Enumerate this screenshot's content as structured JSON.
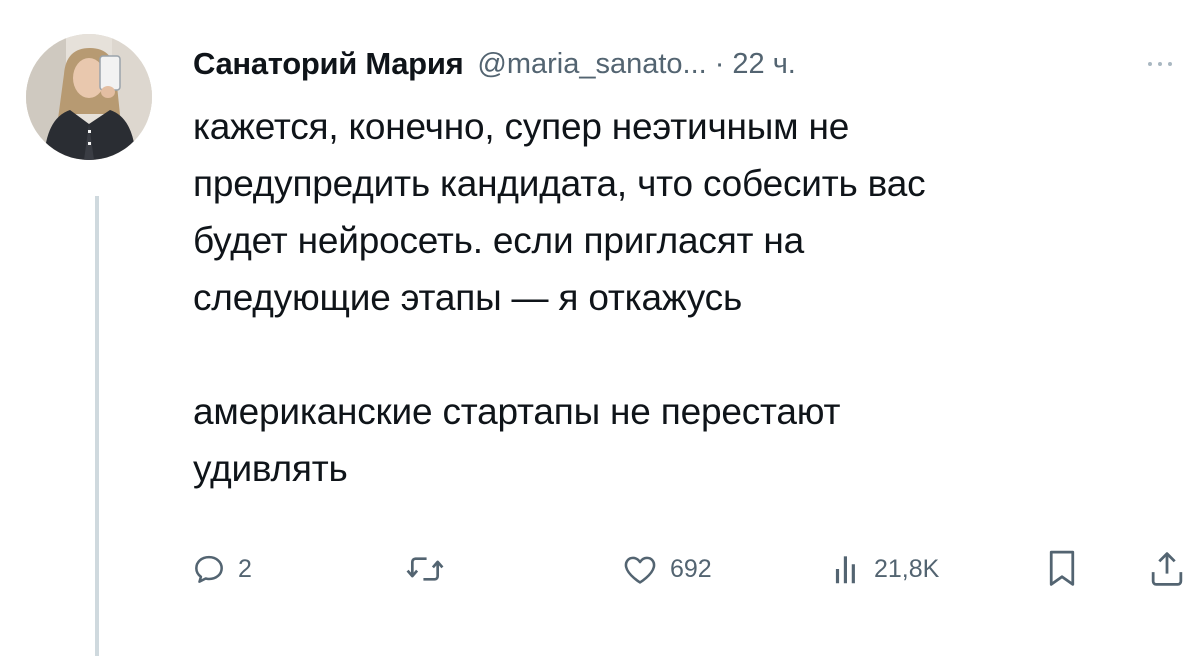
{
  "tweet": {
    "author": {
      "display_name": "Санаторий Мария",
      "handle": "@maria_sanato...",
      "separator": "·",
      "time": "22 ч."
    },
    "text": {
      "paragraph_1": {
        "line_1": "кажется, конечно, супер неэтичным не",
        "line_2": "предупредить кандидата, что собесить вас",
        "line_3": "будет нейросеть. если пригласят на",
        "line_4": "следующие этапы — я откажусь"
      },
      "paragraph_2": {
        "line_1": "американские стартапы не перестают",
        "line_2": "удивлять"
      }
    },
    "actions": {
      "replies": "2",
      "reposts": "",
      "likes": "692",
      "views": "21,8K"
    },
    "icons": {
      "more": "more-dots-icon",
      "reply": "reply-icon",
      "repost": "repost-icon",
      "like": "heart-icon",
      "views": "views-bar-chart-icon",
      "bookmark": "bookmark-icon",
      "share": "share-icon"
    },
    "colors": {
      "text_primary": "#0f1419",
      "text_secondary": "#536471",
      "thread_line": "#cfd9de"
    }
  }
}
